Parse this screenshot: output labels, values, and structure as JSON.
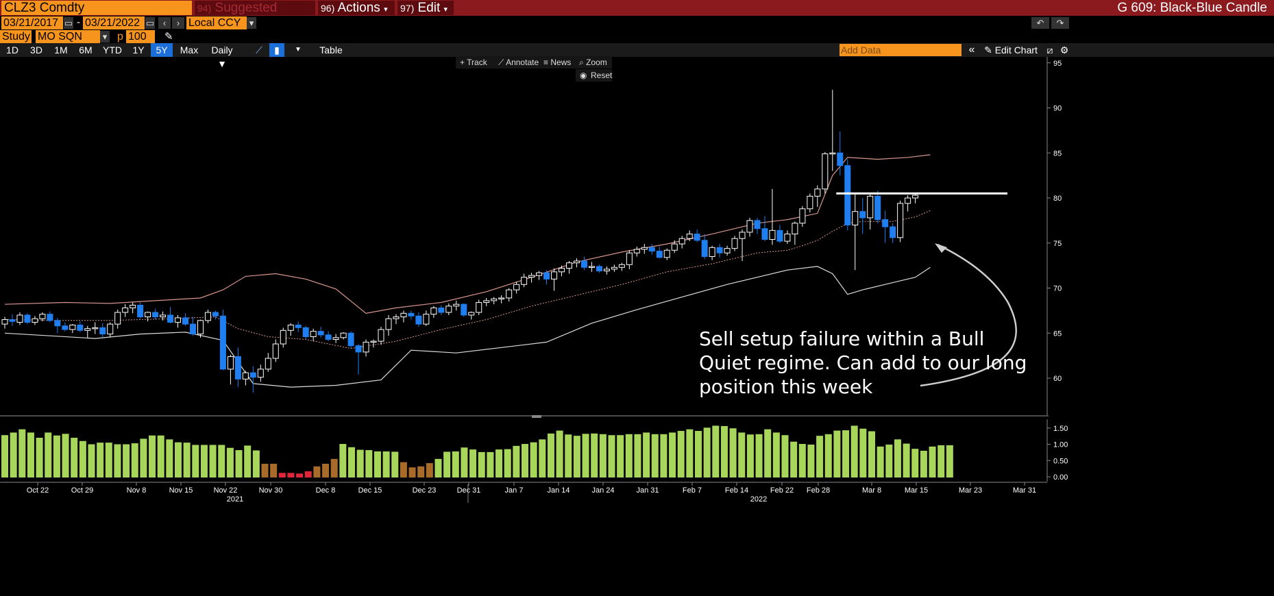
{
  "header": {
    "ticker": "CLZ3 Comdty",
    "suggested_num": "94)",
    "suggested": "Suggested Charts",
    "actions_num": "96)",
    "actions": "Actions",
    "edit_num": "97)",
    "edit": "Edit",
    "chart_title": "G 609: Black-Blue Candle"
  },
  "controls": {
    "start_date": "03/21/2017",
    "dash": "-",
    "end_date": "03/21/2022",
    "currency": "Local CCY",
    "study_label": "Study",
    "study_value": "MO SQN",
    "p_label": "p",
    "p_value": "100"
  },
  "timeframes": [
    "1D",
    "3D",
    "1M",
    "6M",
    "YTD",
    "1Y",
    "5Y",
    "Max"
  ],
  "active_timeframe": "5Y",
  "periodicity": "Daily",
  "table_label": "Table",
  "add_data_placeholder": "Add Data",
  "edit_chart": "Edit Chart",
  "tools": {
    "track": "Track",
    "annotate": "Annotate",
    "news": "News",
    "zoom": "Zoom",
    "reset": "Reset"
  },
  "annotation": "Sell setup failure within a Bull Quiet regime. Can add to our long position this week",
  "colors": {
    "up": "#ffffff",
    "down": "#1f7ff0",
    "bb_upper": "#d9968c",
    "bb_lower": "#dddddd",
    "ma": "#d9968c",
    "vol_green": "#a8d65a",
    "vol_brown": "#a86b2a",
    "vol_red": "#e0263a",
    "accent": "#f7941d",
    "menubar": "#8b1a1f"
  },
  "chart_data": [
    {
      "type": "candlestick",
      "title": "",
      "yticks": [
        60,
        65,
        70,
        75,
        80,
        85,
        90,
        95
      ],
      "ylim": [
        57,
        96
      ],
      "resistance_level": 80.5,
      "x_ticks": [
        "Oct 22",
        "Oct 29",
        "Nov 8",
        "Nov 15",
        "Nov 22",
        "Nov 30",
        "Dec 8",
        "Dec 15",
        "Dec 23",
        "Dec 31",
        "Jan 7",
        "Jan 14",
        "Jan 24",
        "Jan 31",
        "Feb 7",
        "Feb 14",
        "Feb 22",
        "Feb 28",
        "Mar 8",
        "Mar 15",
        "Mar 23",
        "Mar 31"
      ],
      "year_labels": [
        "2021",
        "2022"
      ],
      "candles": [
        [
          66.0,
          66.8,
          65.5,
          66.5
        ],
        [
          66.5,
          67.1,
          65.8,
          66.3
        ],
        [
          66.2,
          67.3,
          65.9,
          67.0
        ],
        [
          67.0,
          67.2,
          66.0,
          66.2
        ],
        [
          66.2,
          66.9,
          65.9,
          66.6
        ],
        [
          66.6,
          67.3,
          66.3,
          67.1
        ],
        [
          67.1,
          67.4,
          66.2,
          66.4
        ],
        [
          66.4,
          66.7,
          65.0,
          65.8
        ],
        [
          65.8,
          66.2,
          65.2,
          65.4
        ],
        [
          65.4,
          66.0,
          65.0,
          65.9
        ],
        [
          65.9,
          66.3,
          65.1,
          65.3
        ],
        [
          65.3,
          65.8,
          64.5,
          65.5
        ],
        [
          65.5,
          66.2,
          64.9,
          65.6
        ],
        [
          65.6,
          66.1,
          64.5,
          64.9
        ],
        [
          64.9,
          66.2,
          64.6,
          66.0
        ],
        [
          66.0,
          67.6,
          65.5,
          67.3
        ],
        [
          67.3,
          68.2,
          66.8,
          67.8
        ],
        [
          67.8,
          68.4,
          67.2,
          68.1
        ],
        [
          68.1,
          68.4,
          66.6,
          66.8
        ],
        [
          66.8,
          67.4,
          66.3,
          67.3
        ],
        [
          67.3,
          67.7,
          66.5,
          66.8
        ],
        [
          66.8,
          67.4,
          66.4,
          67.0
        ],
        [
          67.0,
          67.9,
          66.1,
          66.2
        ],
        [
          66.2,
          67.0,
          65.6,
          66.7
        ],
        [
          66.7,
          67.2,
          65.8,
          66.0
        ],
        [
          66.0,
          66.8,
          64.7,
          64.9
        ],
        [
          64.9,
          66.5,
          64.5,
          66.4
        ],
        [
          66.4,
          67.6,
          66.1,
          67.3
        ],
        [
          67.3,
          67.5,
          66.5,
          66.9
        ],
        [
          66.9,
          67.6,
          60.9,
          61.0
        ],
        [
          61.0,
          62.6,
          59.3,
          62.4
        ],
        [
          62.4,
          63.4,
          59.0,
          59.9
        ],
        [
          59.9,
          60.8,
          59.2,
          60.6
        ],
        [
          60.6,
          61.3,
          58.4,
          60.1
        ],
        [
          60.1,
          61.5,
          59.6,
          61.0
        ],
        [
          61.0,
          62.8,
          60.7,
          62.2
        ],
        [
          62.2,
          64.3,
          61.8,
          63.8
        ],
        [
          63.8,
          65.6,
          63.4,
          65.3
        ],
        [
          65.3,
          66.1,
          64.7,
          65.9
        ],
        [
          65.9,
          66.3,
          65.1,
          65.6
        ],
        [
          65.6,
          65.8,
          64.3,
          64.6
        ],
        [
          64.6,
          65.5,
          64.1,
          65.2
        ],
        [
          65.2,
          65.7,
          64.5,
          64.8
        ],
        [
          64.8,
          65.2,
          64.1,
          64.3
        ],
        [
          64.3,
          64.9,
          63.9,
          64.5
        ],
        [
          64.5,
          65.1,
          64.3,
          65.0
        ],
        [
          65.0,
          65.2,
          63.3,
          63.6
        ],
        [
          63.6,
          63.8,
          60.4,
          62.9
        ],
        [
          62.9,
          64.3,
          62.4,
          64.0
        ],
        [
          64.0,
          64.3,
          63.4,
          64.1
        ],
        [
          64.1,
          65.7,
          63.7,
          65.4
        ],
        [
          65.4,
          67.0,
          64.7,
          66.6
        ],
        [
          66.6,
          67.1,
          66.0,
          66.8
        ],
        [
          66.8,
          67.5,
          66.2,
          67.2
        ],
        [
          67.2,
          67.5,
          66.5,
          66.9
        ],
        [
          66.9,
          67.3,
          65.7,
          66.0
        ],
        [
          66.0,
          67.5,
          65.8,
          67.1
        ],
        [
          67.1,
          68.0,
          66.7,
          67.8
        ],
        [
          67.8,
          68.1,
          67.0,
          67.3
        ],
        [
          67.3,
          68.3,
          67.0,
          68.0
        ],
        [
          68.0,
          68.6,
          67.5,
          68.2
        ],
        [
          68.2,
          68.3,
          66.8,
          67.0
        ],
        [
          67.0,
          67.4,
          66.5,
          67.3
        ],
        [
          67.3,
          68.7,
          67.0,
          68.4
        ],
        [
          68.4,
          68.9,
          68.0,
          68.6
        ],
        [
          68.6,
          69.0,
          68.2,
          68.8
        ],
        [
          68.8,
          69.2,
          68.3,
          68.9
        ],
        [
          68.9,
          70.0,
          68.5,
          69.8
        ],
        [
          69.8,
          70.7,
          69.4,
          70.4
        ],
        [
          70.4,
          71.6,
          70.1,
          71.2
        ],
        [
          71.2,
          71.7,
          70.6,
          71.4
        ],
        [
          71.4,
          71.9,
          70.9,
          71.7
        ],
        [
          71.7,
          72.0,
          70.4,
          71.0
        ],
        [
          71.0,
          72.2,
          69.7,
          71.8
        ],
        [
          71.8,
          72.5,
          71.3,
          72.2
        ],
        [
          72.2,
          73.0,
          71.6,
          72.8
        ],
        [
          72.8,
          73.3,
          72.3,
          73.0
        ],
        [
          73.0,
          73.5,
          72.0,
          72.3
        ],
        [
          72.3,
          72.9,
          71.8,
          72.4
        ],
        [
          72.4,
          72.6,
          71.7,
          71.9
        ],
        [
          71.9,
          72.4,
          71.5,
          72.1
        ],
        [
          72.1,
          72.6,
          71.8,
          72.3
        ],
        [
          72.3,
          72.8,
          71.9,
          72.6
        ],
        [
          72.6,
          74.2,
          72.1,
          73.9
        ],
        [
          73.9,
          74.6,
          73.5,
          74.3
        ],
        [
          74.3,
          74.9,
          73.8,
          74.5
        ],
        [
          74.5,
          74.9,
          73.7,
          74.1
        ],
        [
          74.1,
          74.6,
          73.3,
          73.4
        ],
        [
          73.4,
          74.4,
          73.1,
          74.2
        ],
        [
          74.2,
          75.3,
          73.9,
          74.9
        ],
        [
          74.9,
          75.8,
          74.4,
          75.5
        ],
        [
          75.5,
          76.4,
          75.2,
          76.0
        ],
        [
          76.0,
          76.5,
          75.1,
          75.3
        ],
        [
          75.3,
          76.0,
          73.2,
          73.5
        ],
        [
          73.5,
          74.7,
          73.1,
          74.5
        ],
        [
          74.5,
          74.9,
          73.4,
          73.9
        ],
        [
          73.9,
          74.7,
          73.6,
          74.4
        ],
        [
          74.4,
          75.8,
          74.1,
          75.5
        ],
        [
          75.5,
          76.5,
          73.0,
          76.2
        ],
        [
          76.2,
          77.8,
          75.7,
          77.5
        ],
        [
          77.5,
          77.8,
          76.0,
          76.6
        ],
        [
          76.6,
          78.0,
          75.2,
          75.4
        ],
        [
          75.4,
          81.0,
          74.8,
          76.4
        ],
        [
          76.4,
          77.0,
          75.0,
          75.2
        ],
        [
          75.2,
          76.4,
          74.9,
          76.0
        ],
        [
          76.0,
          77.4,
          74.8,
          77.2
        ],
        [
          77.2,
          79.1,
          76.8,
          78.8
        ],
        [
          78.8,
          80.5,
          78.4,
          80.2
        ],
        [
          80.2,
          81.4,
          79.0,
          81.0
        ],
        [
          81.0,
          85.1,
          80.5,
          84.9
        ],
        [
          84.9,
          92.0,
          83.0,
          85.0
        ],
        [
          85.0,
          87.4,
          82.5,
          83.6
        ],
        [
          83.6,
          84.3,
          76.4,
          77.0
        ],
        [
          77.0,
          80.5,
          72.0,
          78.5
        ],
        [
          78.5,
          80.0,
          76.0,
          77.8
        ],
        [
          77.8,
          80.4,
          76.5,
          80.2
        ],
        [
          80.2,
          80.8,
          77.2,
          77.6
        ],
        [
          77.6,
          78.6,
          75.0,
          76.8
        ],
        [
          76.8,
          77.2,
          75.0,
          75.6
        ],
        [
          75.6,
          79.7,
          75.1,
          79.4
        ],
        [
          79.4,
          80.3,
          78.5,
          80.0
        ],
        [
          80.0,
          80.6,
          79.4,
          80.3
        ]
      ],
      "bb_upper": [
        [
          0,
          68.2
        ],
        [
          8,
          68.4
        ],
        [
          14,
          68.3
        ],
        [
          20,
          68.6
        ],
        [
          26,
          68.9
        ],
        [
          29,
          69.8
        ],
        [
          32,
          71.3
        ],
        [
          36,
          71.6
        ],
        [
          40,
          71.0
        ],
        [
          44,
          69.9
        ],
        [
          48,
          67.2
        ],
        [
          52,
          67.8
        ],
        [
          58,
          68.4
        ],
        [
          64,
          69.6
        ],
        [
          70,
          71.2
        ],
        [
          76,
          72.9
        ],
        [
          82,
          74.0
        ],
        [
          88,
          74.9
        ],
        [
          94,
          76.0
        ],
        [
          100,
          77.2
        ],
        [
          104,
          77.6
        ],
        [
          108,
          78.3
        ],
        [
          110,
          82.5
        ],
        [
          112,
          84.5
        ],
        [
          116,
          84.3
        ],
        [
          120,
          84.5
        ],
        [
          123,
          84.8
        ]
      ],
      "bb_lower": [
        [
          0,
          65.0
        ],
        [
          6,
          64.7
        ],
        [
          12,
          64.4
        ],
        [
          18,
          64.9
        ],
        [
          24,
          65.1
        ],
        [
          29,
          64.2
        ],
        [
          33,
          59.4
        ],
        [
          38,
          59.0
        ],
        [
          44,
          59.2
        ],
        [
          50,
          59.8
        ],
        [
          54,
          63.1
        ],
        [
          60,
          62.8
        ],
        [
          66,
          63.4
        ],
        [
          72,
          64.0
        ],
        [
          78,
          66.1
        ],
        [
          84,
          67.6
        ],
        [
          90,
          69.0
        ],
        [
          96,
          70.4
        ],
        [
          100,
          71.2
        ],
        [
          104,
          72.0
        ],
        [
          108,
          72.4
        ],
        [
          110,
          71.6
        ],
        [
          112,
          69.3
        ],
        [
          114,
          69.8
        ],
        [
          118,
          70.6
        ],
        [
          121,
          71.2
        ],
        [
          123,
          72.3
        ]
      ],
      "ma": [
        [
          0,
          66.5
        ],
        [
          8,
          66.4
        ],
        [
          14,
          66.4
        ],
        [
          22,
          66.6
        ],
        [
          28,
          66.8
        ],
        [
          31,
          65.5
        ],
        [
          35,
          64.6
        ],
        [
          40,
          64.3
        ],
        [
          46,
          63.3
        ],
        [
          52,
          64.1
        ],
        [
          58,
          65.4
        ],
        [
          64,
          66.5
        ],
        [
          70,
          68.0
        ],
        [
          76,
          69.2
        ],
        [
          82,
          70.4
        ],
        [
          88,
          71.8
        ],
        [
          94,
          72.7
        ],
        [
          100,
          73.9
        ],
        [
          104,
          74.2
        ],
        [
          106,
          74.7
        ],
        [
          108,
          75.3
        ],
        [
          110,
          76.3
        ],
        [
          112,
          77.2
        ],
        [
          114,
          77.4
        ],
        [
          118,
          77.4
        ],
        [
          121,
          77.9
        ],
        [
          123,
          78.6
        ]
      ]
    },
    {
      "type": "bar",
      "title": "",
      "yticks": [
        0.0,
        0.5,
        1.0,
        1.5
      ],
      "ylim": [
        -0.08,
        1.6
      ],
      "volumes": [
        1.28,
        1.36,
        1.46,
        1.36,
        1.2,
        1.36,
        1.27,
        1.32,
        1.2,
        1.1,
        1.0,
        1.05,
        1.05,
        1.0,
        1.0,
        1.03,
        1.17,
        1.27,
        1.27,
        1.15,
        1.06,
        1.05,
        0.98,
        0.98,
        0.98,
        0.98,
        0.89,
        0.82,
        0.96,
        0.81,
        0.4,
        0.4,
        0.12,
        0.12,
        0.1,
        0.17,
        0.32,
        0.4,
        0.55,
        1.01,
        0.91,
        0.83,
        0.82,
        0.78,
        0.78,
        0.77,
        0.45,
        0.29,
        0.32,
        0.42,
        0.55,
        0.77,
        0.78,
        0.9,
        0.84,
        0.76,
        0.76,
        0.84,
        0.85,
        0.95,
        1.01,
        1.06,
        1.15,
        1.33,
        1.42,
        1.3,
        1.26,
        1.32,
        1.33,
        1.31,
        1.28,
        1.28,
        1.31,
        1.31,
        1.36,
        1.31,
        1.31,
        1.36,
        1.41,
        1.46,
        1.41,
        1.51,
        1.57,
        1.56,
        1.49,
        1.36,
        1.3,
        1.31,
        1.46,
        1.36,
        1.28,
        1.08,
        1.01,
        0.99,
        1.26,
        1.31,
        1.42,
        1.43,
        1.57,
        1.48,
        1.4,
        0.93,
        0.99,
        1.15,
        1.02,
        0.86,
        0.8,
        0.93,
        0.97,
        0.97
      ],
      "colors_idx": {
        "brown": [
          30,
          31,
          36,
          37,
          38,
          46,
          47,
          48,
          49
        ],
        "red": [
          32,
          33,
          34,
          35
        ]
      }
    }
  ]
}
